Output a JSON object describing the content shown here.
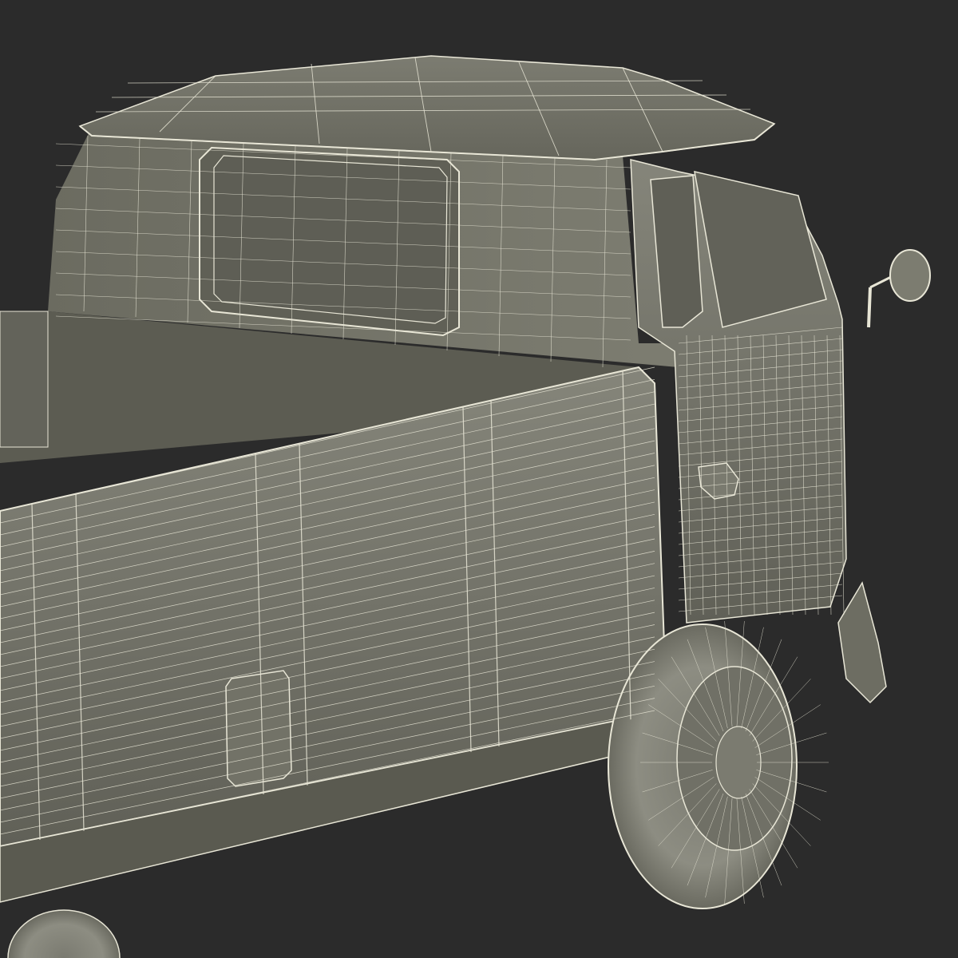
{
  "scene": {
    "subject": "pickup-truck-wireframe-render",
    "colors": {
      "background": "#2b2b2b",
      "body": "#6e6e62",
      "body_light": "#8a8a7c",
      "body_dark": "#55554b",
      "interior": "#5c5c52",
      "glass": "#5e5e55",
      "wire": "#e8e6d6",
      "tire": "#8a8a7f"
    }
  }
}
